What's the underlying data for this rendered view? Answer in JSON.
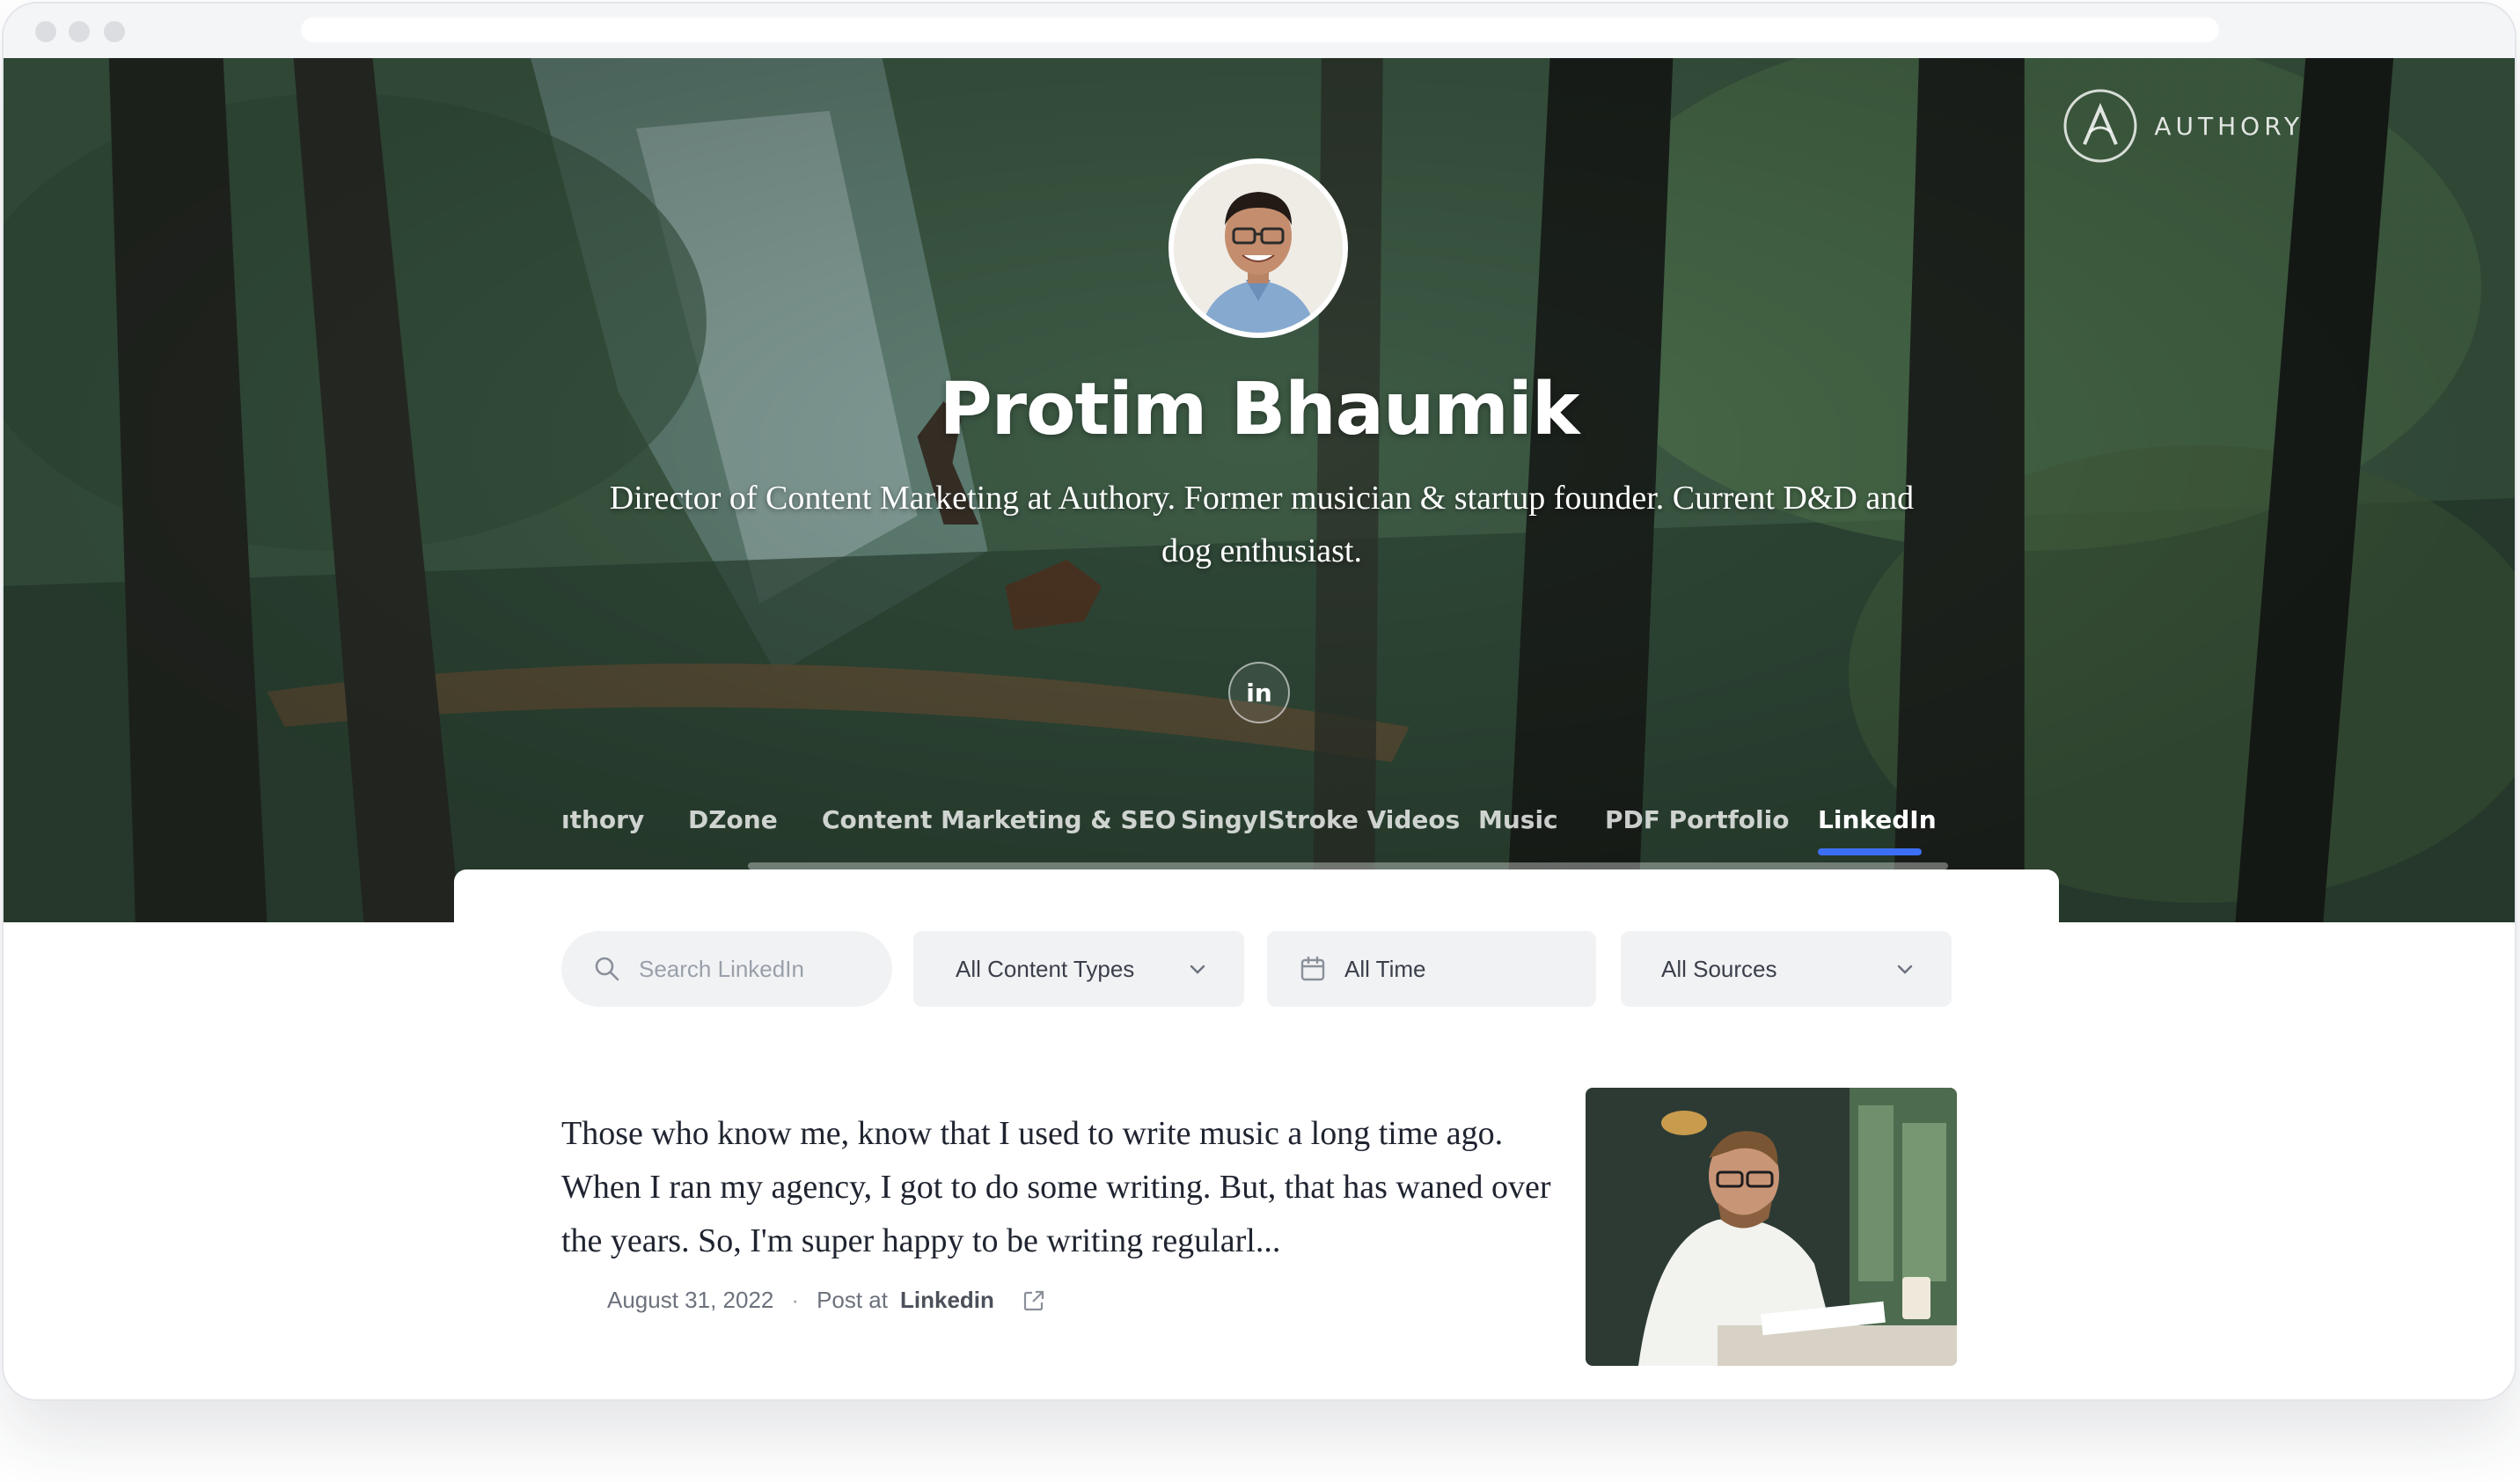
{
  "browser": {
    "traffic_lights": [
      "close",
      "minimize",
      "maximize"
    ]
  },
  "brand": {
    "name": "AUTHORY",
    "icon": "authory-logo-icon"
  },
  "profile": {
    "name": "Protim Bhaumik",
    "bio": "Director of Content Marketing at Authory. Former musician & startup founder. Current D&D and dog enthusiast.",
    "social": [
      {
        "label": "in",
        "icon": "linkedin-icon"
      }
    ]
  },
  "tabs": [
    {
      "label": "ıthory",
      "active": false
    },
    {
      "label": "DZone",
      "active": false
    },
    {
      "label": "Content Marketing & SEO",
      "active": false
    },
    {
      "label": "SingyIStroke Videos",
      "active": false
    },
    {
      "label": "Music",
      "active": false
    },
    {
      "label": "PDF Portfolio",
      "active": false
    },
    {
      "label": "LinkedIn",
      "active": true
    }
  ],
  "filters": {
    "search_placeholder": "Search LinkedIn",
    "content_types": "All Content Types",
    "time": "All Time",
    "sources": "All Sources"
  },
  "posts": [
    {
      "excerpt": "Those who know me, know that I used to write music a long time ago. When I ran my agency, I got to do some writing. But, that has waned over the years. So, I'm super happy to be writing regularl...",
      "date": "August 31, 2022",
      "separator": "·",
      "type_prefix": "Post at",
      "source": "Linkedin"
    }
  ],
  "colors": {
    "accent": "#3c6ff5",
    "filter_bg": "#f1f2f4",
    "text_dark": "#1f2430",
    "meta_text": "#6c727d"
  }
}
